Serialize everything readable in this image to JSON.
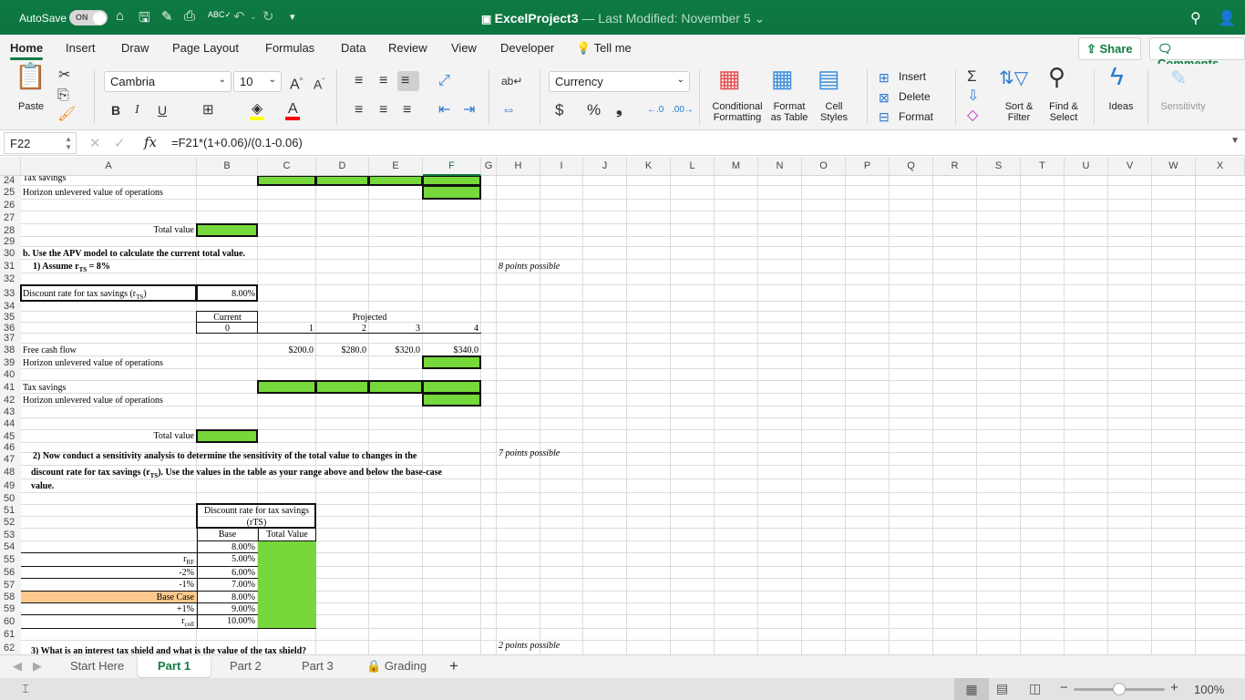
{
  "titlebar": {
    "autosave_label": "AutoSave",
    "autosave_state": "ON",
    "doc_name": "ExcelProject3",
    "doc_subtitle": "— Last Modified: November 5",
    "qat_icons": [
      "home-icon",
      "save-sync-icon",
      "edit-icon",
      "print-icon",
      "spellcheck-icon",
      "undo-icon",
      "redo-icon",
      "customize-icon"
    ]
  },
  "menu_tabs": [
    "Home",
    "Insert",
    "Draw",
    "Page Layout",
    "Formulas",
    "Data",
    "Review",
    "View",
    "Developer",
    "Tell me"
  ],
  "active_tab": "Home",
  "share_label": "Share",
  "comments_label": "Comments",
  "ribbon": {
    "paste": "Paste",
    "font_name": "Cambria",
    "font_size": "10",
    "bold": "B",
    "italic": "I",
    "underline": "U",
    "number_format": "Currency",
    "currency_symbol": "$",
    "percent_symbol": "%",
    "comma_symbol": "❟",
    "conditional_formatting": "Conditional Formatting",
    "format_as_table": "Format as Table",
    "cell_styles": "Cell Styles",
    "insert": "Insert",
    "delete": "Delete",
    "format": "Format",
    "sort_filter": "Sort & Filter",
    "find_select": "Find & Select",
    "ideas": "Ideas",
    "sensitivity": "Sensitivity",
    "colors": {
      "highlight": "#ffff00",
      "font_color": "#ff0000"
    }
  },
  "formula_bar": {
    "name_box": "F22",
    "formula": "=F21*(1+0.06)/(0.1-0.06)"
  },
  "columns": [
    "A",
    "B",
    "C",
    "D",
    "E",
    "F",
    "G",
    "H",
    "I",
    "J",
    "K",
    "L",
    "M",
    "N",
    "O",
    "P",
    "Q",
    "R",
    "S",
    "T",
    "U",
    "V",
    "W",
    "X"
  ],
  "selected_column": "F",
  "rows": [
    "24",
    "25",
    "26",
    "27",
    "28",
    "29",
    "30",
    "31",
    "32",
    "33",
    "34",
    "35",
    "36",
    "37",
    "38",
    "39",
    "40",
    "41",
    "42",
    "43",
    "44",
    "45",
    "46",
    "47",
    "48",
    "49",
    "50",
    "51",
    "52",
    "53",
    "54",
    "55",
    "56",
    "57",
    "58",
    "59",
    "60",
    "61",
    "62"
  ],
  "cells": {
    "a24": "Tax savings",
    "a25": "Horizon unlevered value of operations",
    "a28_label": "Total value",
    "a30": "b. Use the APV model to calculate the current total value.",
    "a31": "1) Assume r",
    "a31_sub": "TS",
    "a31_tail": " = 8%",
    "h31": "8 points possible",
    "a33": "Discount rate for tax savings (r",
    "a33_sub": "TS",
    "a33_tail": ")",
    "b33": "8.00%",
    "b35": "Current",
    "d35": "Projected",
    "b36": "0",
    "c36": "1",
    "d36": "2",
    "e36": "3",
    "f36": "4",
    "a38": "Free cash flow",
    "c38": "$200.0",
    "d38": "$280.0",
    "e38": "$320.0",
    "f38": "$340.0",
    "a39": "Horizon unlevered value of operations",
    "a41": "Tax savings",
    "a42": "Horizon unlevered value of operations",
    "a45_label": "Total value",
    "a47": "2) Now conduct a sensitivity analysis to determine the sensitivity of the total value to changes in the",
    "a48": "discount rate for tax savings (r",
    "a48_sub": "TS",
    "a48_tail": ").  Use the values in the table as your range above and below the base-case",
    "a49": "value.",
    "h47": "7 points possible",
    "b51": "Discount rate for tax savings",
    "b52": "(rTS)",
    "b53": "Base",
    "c53": "Total Value",
    "b54": "8.00%",
    "h62": "2 points possible",
    "a62": "3) What is an interest tax shield and what is the value of the tax shield?"
  },
  "sensitivity_rows": [
    {
      "label": "r",
      "sub": "RF",
      "rate": "5.00%"
    },
    {
      "label": "-2%",
      "sub": "",
      "rate": "6.00%"
    },
    {
      "label": "-1%",
      "sub": "",
      "rate": "7.00%"
    },
    {
      "label": "Base Case",
      "sub": "",
      "rate": "8.00%"
    },
    {
      "label": "+1%",
      "sub": "",
      "rate": "9.00%"
    },
    {
      "label": "r",
      "sub": "coll",
      "rate": "10.00%"
    }
  ],
  "fill_colors": {
    "input": "#76d83a",
    "base_case": "#fdc98f"
  },
  "sheet_tabs": [
    "Start Here",
    "Part 1",
    "Part 2",
    "Part 3",
    "Grading"
  ],
  "active_sheet": "Part 1",
  "status": {
    "zoom": "100%",
    "zoom_fraction": 0.5
  }
}
